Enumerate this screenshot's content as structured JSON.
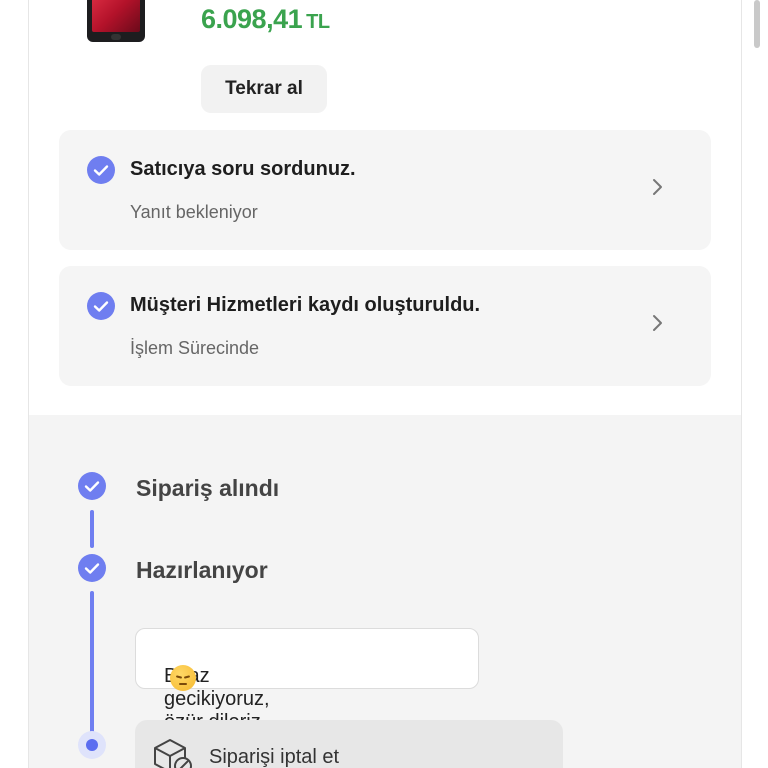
{
  "product": {
    "price_value": "6.098,41",
    "price_currency": "TL",
    "repurchase_label": "Tekrar al"
  },
  "info_cards": [
    {
      "title": "Satıcıya soru sordunuz.",
      "subtitle": "Yanıt bekleniyor"
    },
    {
      "title": "Müşteri Hizmetleri kaydı oluşturuldu.",
      "subtitle": "İşlem Sürecinde"
    }
  ],
  "timeline": {
    "steps": [
      {
        "label": "Sipariş alındı",
        "status": "done"
      },
      {
        "label": "Hazırlanıyor",
        "status": "done"
      }
    ],
    "delay_message": "Biraz gecikiyoruz, özür dileriz",
    "cancel_label": "Siparişi iptal et"
  },
  "colors": {
    "accent": "#6f7ef0",
    "price": "#3aa34e",
    "card_bg": "#f5f5f5",
    "timeline_bg": "#f4f4f4"
  },
  "icons": [
    "check-circle-icon",
    "chevron-right-icon",
    "sad-face-emoji-icon",
    "package-cancel-icon"
  ]
}
